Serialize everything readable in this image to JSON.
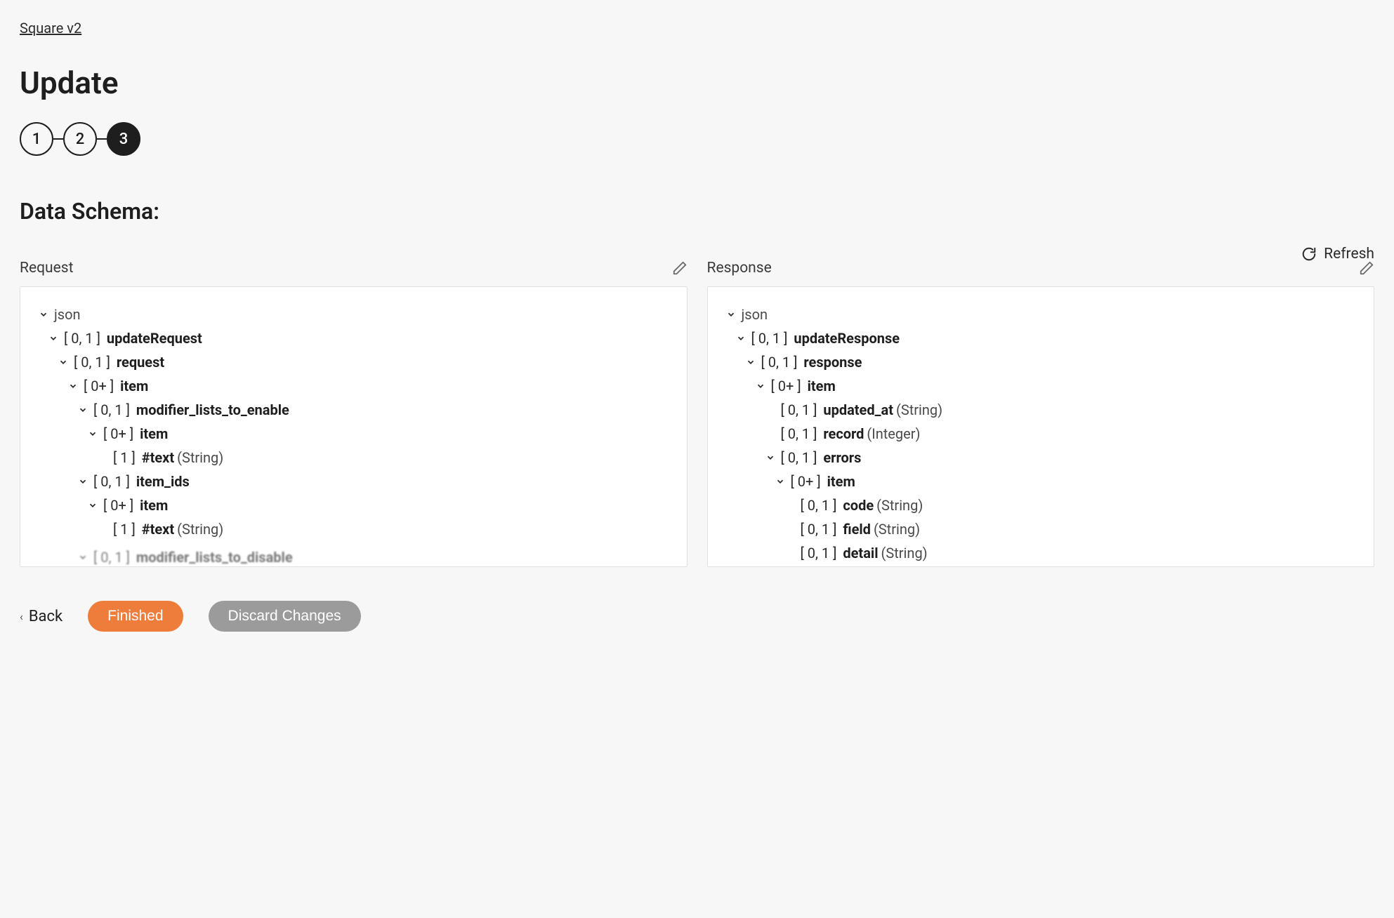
{
  "breadcrumb": "Square v2",
  "page_title": "Update",
  "stepper": {
    "steps": [
      "1",
      "2",
      "3"
    ],
    "active_index": 2
  },
  "section_heading": "Data Schema:",
  "refresh_label": "Refresh",
  "panels": {
    "request": {
      "label": "Request"
    },
    "response": {
      "label": "Response"
    }
  },
  "tree_request": {
    "root": "json",
    "l1_card": "[ 0, 1 ]",
    "l1_name": "updateRequest",
    "l2_card": "[ 0, 1 ]",
    "l2_name": "request",
    "l3_card": "[ 0+ ]",
    "l3_name": "item",
    "l4a_card": "[ 0, 1 ]",
    "l4a_name": "modifier_lists_to_enable",
    "l5a_card": "[ 0+ ]",
    "l5a_name": "item",
    "l6a_card": "[ 1 ]",
    "l6a_name": "#text",
    "l6a_type": "(String)",
    "l4b_card": "[ 0, 1 ]",
    "l4b_name": "item_ids",
    "l5b_card": "[ 0+ ]",
    "l5b_name": "item",
    "l6b_card": "[ 1 ]",
    "l6b_name": "#text",
    "l6b_type": "(String)",
    "l4c_card": "[ 0, 1 ]",
    "l4c_name": "modifier_lists_to_disable"
  },
  "tree_response": {
    "root": "json",
    "l1_card": "[ 0, 1 ]",
    "l1_name": "updateResponse",
    "l2_card": "[ 0, 1 ]",
    "l2_name": "response",
    "l3_card": "[ 0+ ]",
    "l3_name": "item",
    "l4a_card": "[ 0, 1 ]",
    "l4a_name": "updated_at",
    "l4a_type": "(String)",
    "l4b_card": "[ 0, 1 ]",
    "l4b_name": "record",
    "l4b_type": "(Integer)",
    "l4c_card": "[ 0, 1 ]",
    "l4c_name": "errors",
    "l5_card": "[ 0+ ]",
    "l5_name": "item",
    "l6a_card": "[ 0, 1 ]",
    "l6a_name": "code",
    "l6a_type": "(String)",
    "l6b_card": "[ 0, 1 ]",
    "l6b_name": "field",
    "l6b_type": "(String)",
    "l6c_card": "[ 0, 1 ]",
    "l6c_name": "detail",
    "l6c_type": "(String)"
  },
  "footer": {
    "back": "Back",
    "finished": "Finished",
    "discard": "Discard Changes"
  }
}
